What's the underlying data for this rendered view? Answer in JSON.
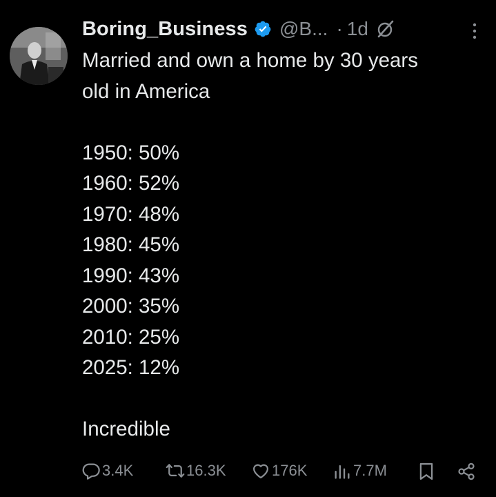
{
  "author": {
    "name": "Boring_Business",
    "handle": "@B...",
    "separator": "·",
    "time": "1d",
    "verified": true,
    "verified_color": "#1d9bf0"
  },
  "tweet": {
    "lines": [
      "Married and own a home by 30 years",
      "old in America",
      "",
      "1950: 50%",
      "1960: 52%",
      "1970: 48%",
      "1980: 45%",
      "1990: 43%",
      "2000: 35%",
      "2010: 25%",
      "2025: 12%",
      "",
      "Incredible"
    ]
  },
  "actions": {
    "replies": "3.4K",
    "reposts": "16.3K",
    "likes": "176K",
    "views": "7.7M"
  },
  "colors": {
    "background": "#000000",
    "text": "#e7e9ea",
    "muted": "#8b8f94",
    "accent": "#1d9bf0"
  },
  "icons": {
    "verified": "verified-badge-icon",
    "grok": "grok-icon",
    "more": "more-options-icon",
    "reply": "reply-icon",
    "repost": "repost-icon",
    "like": "heart-icon",
    "views": "views-chart-icon",
    "bookmark": "bookmark-icon",
    "share": "share-icon"
  }
}
